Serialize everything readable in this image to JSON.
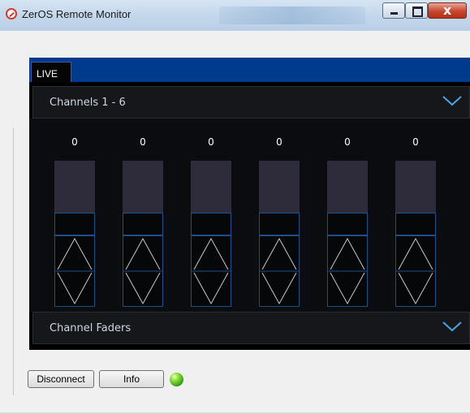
{
  "window": {
    "title": "ZerOS Remote Monitor",
    "controls": {
      "minimize": "minimize",
      "maximize": "maximize",
      "close": "close"
    }
  },
  "tab": {
    "label": "LIVE"
  },
  "sections": {
    "channels_header": "Channels 1 - 6",
    "faders_header": "Channel Faders"
  },
  "faders": [
    {
      "value": "0",
      "level": 0
    },
    {
      "value": "0",
      "level": 0
    },
    {
      "value": "0",
      "level": 0
    },
    {
      "value": "0",
      "level": 0
    },
    {
      "value": "0",
      "level": 0
    },
    {
      "value": "0",
      "level": 0
    }
  ],
  "buttons": {
    "disconnect": "Disconnect",
    "info": "Info"
  },
  "status": {
    "connected_color": "#3cc21a"
  },
  "colors": {
    "accent": "#003a8c",
    "chevron": "#4aa3e8"
  }
}
